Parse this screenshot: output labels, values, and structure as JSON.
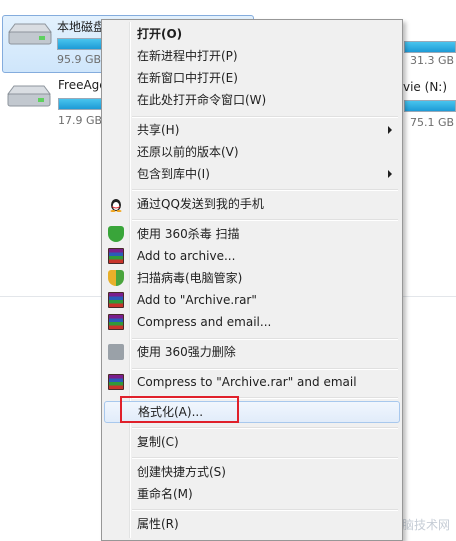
{
  "background": {
    "drives": [
      {
        "name": "本地磁盘",
        "free": "95.9 GB",
        "fill_percent": 30
      },
      {
        "name": "FreeAge",
        "free": "17.9 GB",
        "fill_percent": 25
      }
    ],
    "right_items": [
      {
        "free": "31.3 GB"
      },
      {
        "name": "vie (N:)",
        "free": "75.1 GB"
      }
    ],
    "watermark": "电脑技术网"
  },
  "menu": {
    "items": [
      {
        "label": "打开(O)",
        "bold": true
      },
      {
        "label": "在新进程中打开(P)"
      },
      {
        "label": "在新窗口中打开(E)"
      },
      {
        "label": "在此处打开命令窗口(W)"
      },
      {
        "label": "共享(H)",
        "submenu": true
      },
      {
        "label": "还原以前的版本(V)"
      },
      {
        "label": "包含到库中(I)",
        "submenu": true
      },
      {
        "label": "通过QQ发送到我的手机",
        "icon": "qq-penguin-icon"
      },
      {
        "label": "使用 360杀毒 扫描",
        "icon": "360-shield-icon"
      },
      {
        "label": "Add to archive...",
        "icon": "winrar-icon"
      },
      {
        "label": "扫描病毒(电脑管家)",
        "icon": "pc-manager-icon"
      },
      {
        "label": "Add to \"Archive.rar\"",
        "icon": "winrar-icon"
      },
      {
        "label": "Compress and email...",
        "icon": "winrar-icon"
      },
      {
        "label": "使用 360强力删除",
        "icon": "shredder-icon"
      },
      {
        "label": "Compress to \"Archive.rar\" and email",
        "icon": "winrar-icon"
      },
      {
        "label": "格式化(A)...",
        "highlighted": true
      },
      {
        "label": "复制(C)"
      },
      {
        "label": "创建快捷方式(S)"
      },
      {
        "label": "重命名(M)"
      },
      {
        "label": "属性(R)"
      }
    ]
  },
  "colors": {
    "highlight_border": "#e0202a",
    "hover_border": "#a8c8ed",
    "progress": "#1e9bd6"
  }
}
